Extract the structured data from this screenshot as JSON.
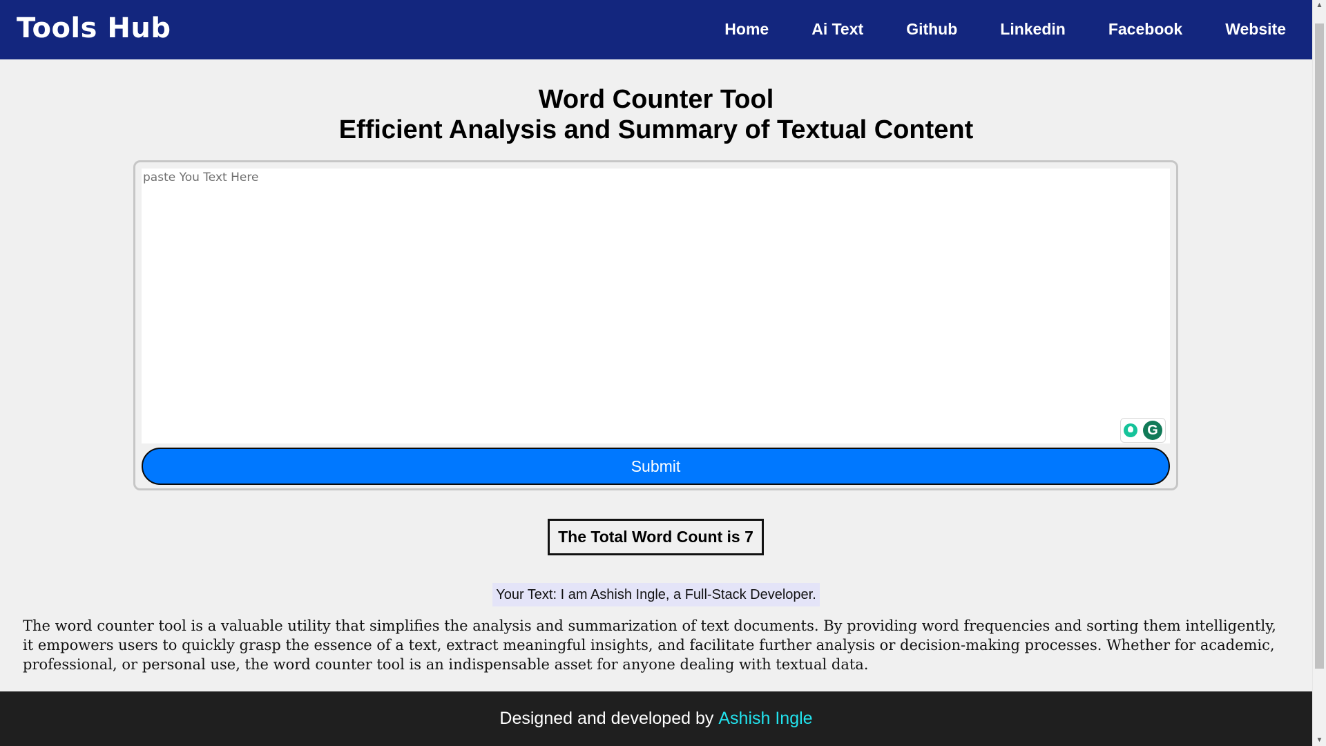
{
  "header": {
    "brand": "Tools Hub",
    "nav": [
      "Home",
      "Ai Text",
      "Github",
      "Linkedin",
      "Facebook",
      "Website"
    ]
  },
  "main": {
    "title": "Word Counter Tool",
    "subtitle": "Efficient Analysis and Summary of Textual Content",
    "textarea_placeholder": "paste You Text Here",
    "textarea_value": "",
    "submit_label": "Submit",
    "word_count_text": "The Total Word Count is 7",
    "your_text": "Your Text: I am Ashish Ingle, a Full-Stack Developer.",
    "description": "The word counter tool is a valuable utility that simplifies the analysis and summarization of text documents. By providing word frequencies and sorting them intelligently, it empowers users to quickly grasp the essence of a text, extract meaningful insights, and facilitate further analysis or decision-making processes. Whether for academic, professional, or personal use, the word counter tool is an indispensable asset for anyone dealing with textual data."
  },
  "footer": {
    "credit": "Designed and developed by",
    "author": "Ashish Ingle"
  },
  "colors": {
    "header_bg": "#13267e",
    "submit_bg": "#0078ff",
    "footer_bg": "#1f1f1f",
    "author_link": "#22e3ee",
    "your_text_bg": "#e4e4f8"
  },
  "icons": {
    "grammarly_bulb": "grammarly-suggestion-icon",
    "grammarly_logo": "grammarly-icon"
  }
}
